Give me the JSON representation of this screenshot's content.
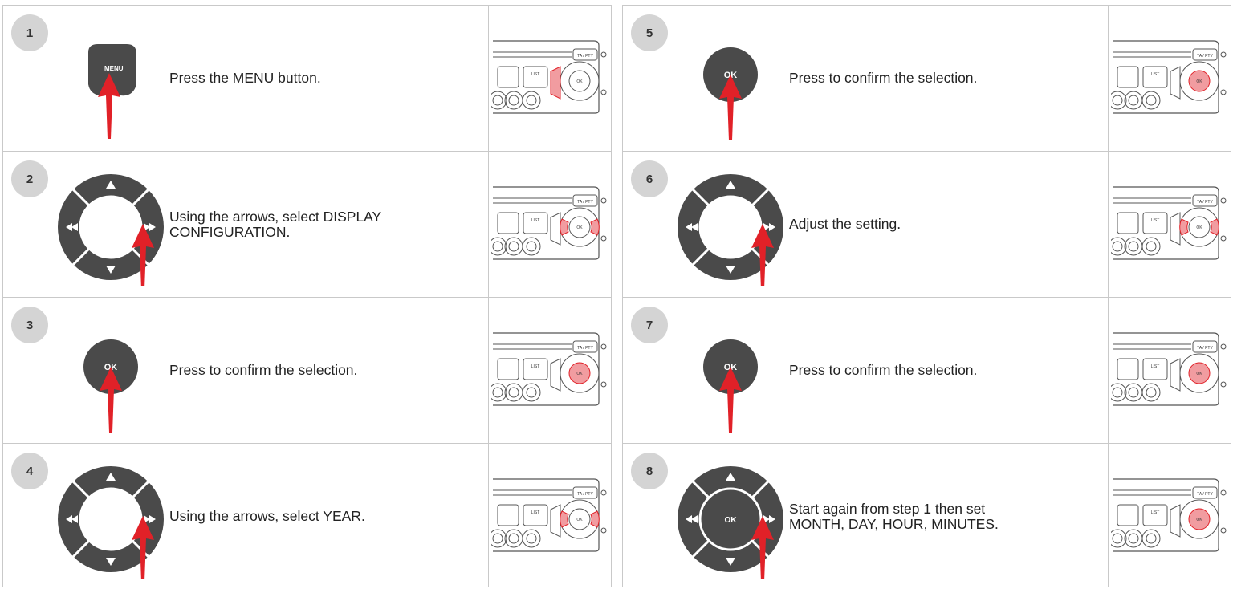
{
  "colors": {
    "accent": "#e12128",
    "button": "#4a4a4a",
    "badge": "#d4d4d4"
  },
  "steps": [
    {
      "number": "1",
      "icon": "menu-button-icon",
      "text": "Press the MENU button.",
      "menu_label": "MENU",
      "highlight": "menu"
    },
    {
      "number": "2",
      "icon": "navigation-arrows-icon",
      "text": "Using the arrows, select DISPLAY\nCONFIGURATION.",
      "highlight": "arrows"
    },
    {
      "number": "3",
      "icon": "ok-button-icon",
      "text": "Press to confirm the selection.",
      "ok_label": "OK",
      "highlight": "ok"
    },
    {
      "number": "4",
      "icon": "navigation-arrows-icon",
      "text": "Using the arrows, select YEAR.",
      "highlight": "arrows"
    },
    {
      "number": "5",
      "icon": "ok-button-icon",
      "text": "Press to confirm the selection.",
      "ok_label": "OK",
      "highlight": "ok"
    },
    {
      "number": "6",
      "icon": "navigation-arrows-icon",
      "text": "Adjust the setting.",
      "highlight": "arrows"
    },
    {
      "number": "7",
      "icon": "ok-button-icon",
      "text": "Press to confirm the selection.",
      "ok_label": "OK",
      "highlight": "ok"
    },
    {
      "number": "8",
      "icon": "navigation-arrows-ok-icon",
      "text": "Start again from step 1 then set\nMONTH, DAY, HOUR, MINUTES.",
      "ok_label": "OK",
      "highlight": "ok"
    }
  ],
  "radio": {
    "ta_label": "TA / PTY",
    "list_label": "LIST",
    "ok_label": "OK"
  }
}
